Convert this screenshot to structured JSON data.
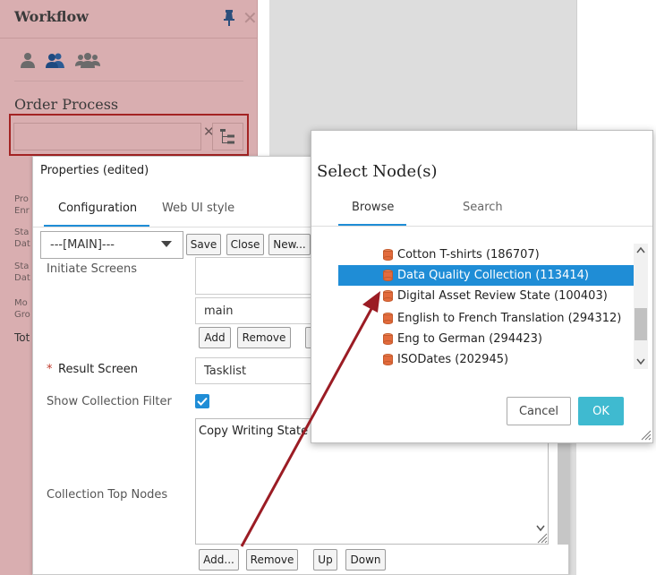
{
  "workflow_panel": {
    "title": "Workflow",
    "process_title": "Order Process",
    "node_input": {
      "value": "",
      "clear_symbol": "✕"
    },
    "side_labels": [
      "Pro",
      "Enr",
      "Sta",
      "Dat",
      "Sta",
      "Dat",
      "Mo",
      "Gro",
      "Tot"
    ]
  },
  "properties_dialog": {
    "title": "Properties (edited)",
    "tabs": [
      {
        "label": "Configuration",
        "active": true
      },
      {
        "label": "Web UI style",
        "active": false
      }
    ],
    "profile_select": "---[MAIN]---",
    "toolbar": {
      "save": "Save",
      "close": "Close",
      "new": "New..."
    },
    "fields": {
      "initiate_screens": {
        "label": "Initiate Screens",
        "value": "main",
        "add": "Add",
        "remove": "Remove"
      },
      "result_screen": {
        "required_mark": "*",
        "label": "Result Screen",
        "value": "Tasklist"
      },
      "show_collection_filter": {
        "label": "Show Collection Filter",
        "checked": true
      },
      "collection_top_nodes": {
        "label": "Collection Top Nodes",
        "values": [
          "Copy Writing State"
        ],
        "buttons": {
          "add": "Add...",
          "remove": "Remove",
          "up": "Up",
          "down": "Down"
        }
      }
    }
  },
  "select_dialog": {
    "title": "Select Node(s)",
    "tabs": [
      {
        "label": "Browse",
        "active": true
      },
      {
        "label": "Search",
        "active": false
      }
    ],
    "nodes": [
      {
        "label": "Cotton T-shirts (186707)",
        "selected": false
      },
      {
        "label": "Data Quality Collection (113414)",
        "selected": true
      },
      {
        "label": "Digital Asset Review State (100403)",
        "selected": false
      },
      {
        "label": "English to French Translation (294312)",
        "selected": false
      },
      {
        "label": "Eng to German (294423)",
        "selected": false
      },
      {
        "label": "ISODates (202945)",
        "selected": false
      }
    ],
    "cancel": "Cancel",
    "ok": "OK"
  },
  "colors": {
    "accent": "#1f8dd6",
    "ok_button": "#3fbad0",
    "highlight_border": "#a32323",
    "arrow": "#9b1c24",
    "panel_overlay": "#d9aeb0",
    "node_icon": "#e36b3d"
  },
  "icons": [
    "pin-icon",
    "close-icon",
    "single-user-icon",
    "user-pair-icon",
    "user-group-icon",
    "tree-picker-icon",
    "chevron-down-icon",
    "checkmark-icon",
    "database-icon",
    "scroll-up-icon",
    "scroll-down-icon",
    "resize-grip-icon"
  ]
}
